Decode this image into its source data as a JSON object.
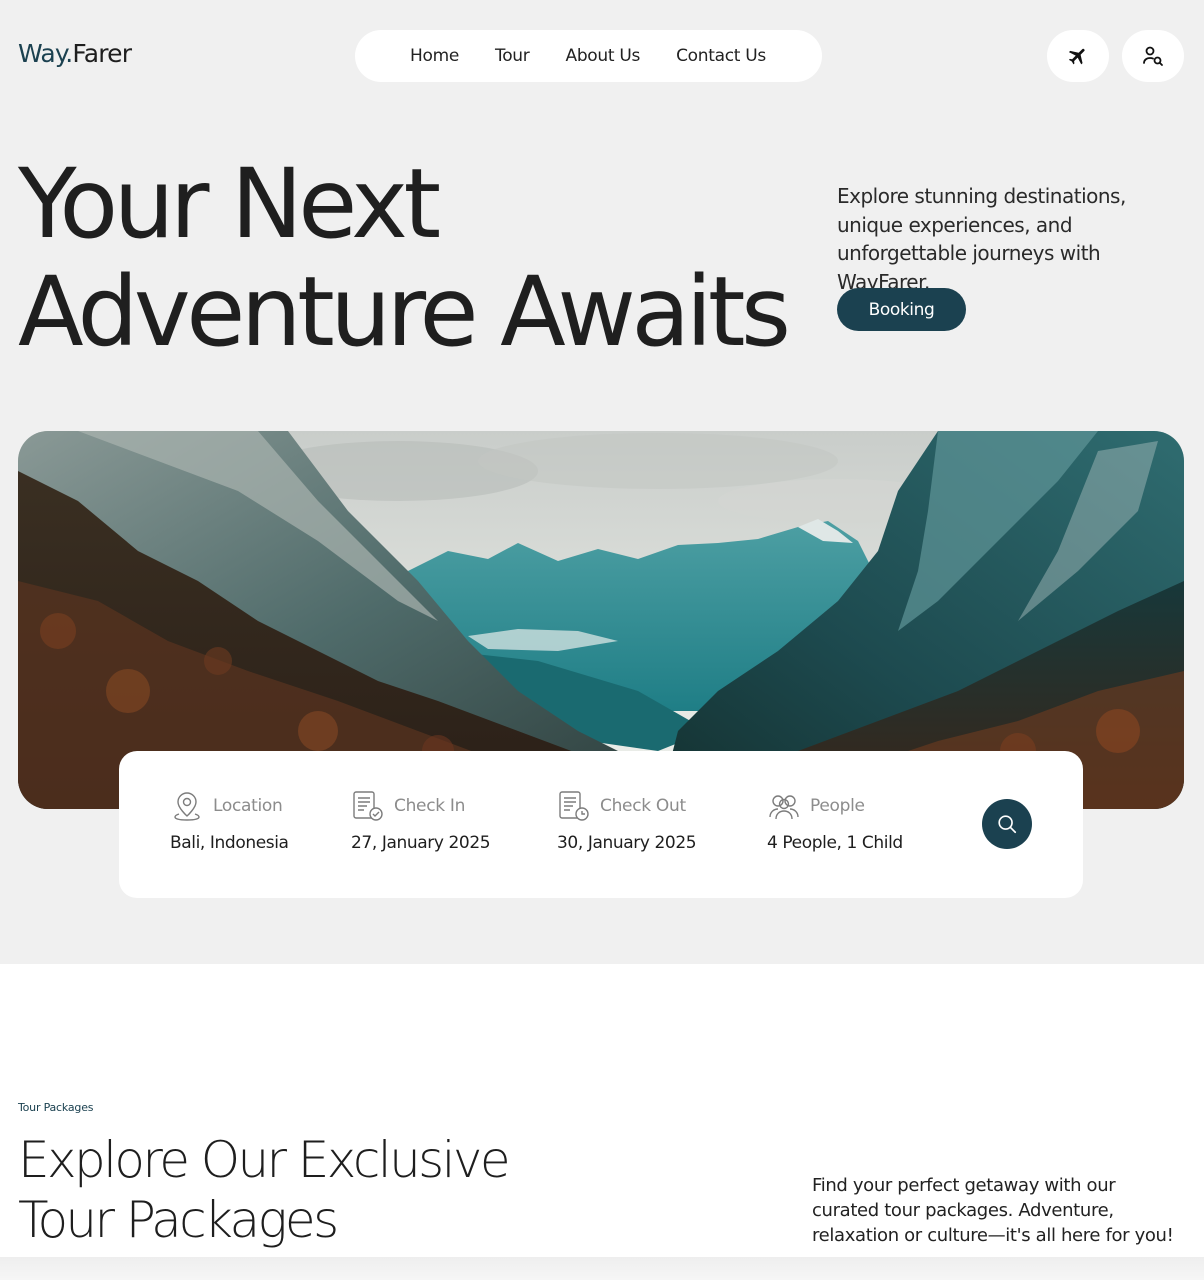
{
  "header": {
    "logo_way": "Way.",
    "logo_farer": "Farer",
    "nav": [
      "Home",
      "Tour",
      "About Us",
      "Contact Us"
    ],
    "icons": [
      "plane-icon",
      "user-search-icon"
    ]
  },
  "hero": {
    "title_line1": "Your Next",
    "title_line2": "Adventure Awaits",
    "description": "Explore stunning destinations, unique experiences, and unforgettable journeys with WayFarer.",
    "booking_label": "Booking"
  },
  "search": {
    "fields": [
      {
        "label": "Location",
        "value": "Bali, Indonesia",
        "icon": "map-pin-icon"
      },
      {
        "label": "Check In",
        "value": "27, January 2025",
        "icon": "check-in-icon"
      },
      {
        "label": "Check Out",
        "value": "30, January 2025",
        "icon": "check-out-icon"
      },
      {
        "label": "People",
        "value": "4 People, 1 Child",
        "icon": "people-icon"
      }
    ],
    "button_icon": "search-icon"
  },
  "tour_packages": {
    "eyebrow": "Tour Packages",
    "title_line1": "Explore Our Exclusive",
    "title_line2": "Tour Packages",
    "description": "Find your perfect getaway with our curated tour packages. Adventure, relaxation or culture—it's all here for you!"
  },
  "colors": {
    "brand": "#1b4150",
    "page_bg": "#f0f0f0",
    "card_bg": "#ffffff"
  }
}
